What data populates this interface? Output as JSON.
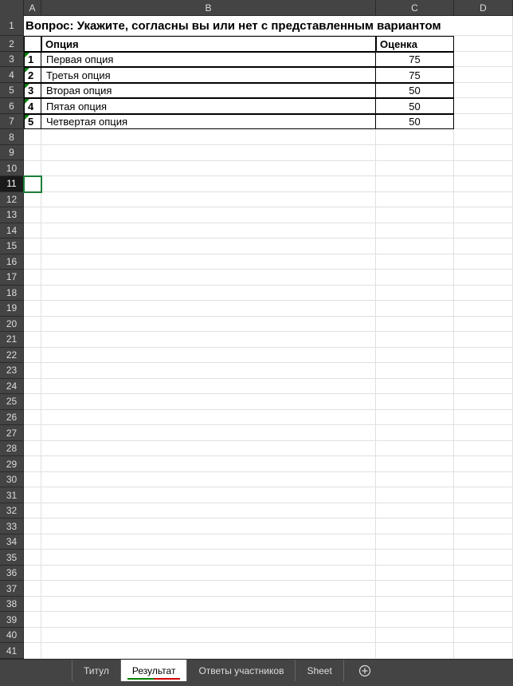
{
  "columns": [
    "A",
    "B",
    "C",
    "D"
  ],
  "title": "Вопрос: Укажите, согласны вы или нет с представленным вариантом",
  "headers": {
    "option": "Опция",
    "score": "Оценка"
  },
  "rows": [
    {
      "n": "1",
      "option": "Первая опция",
      "score": "75"
    },
    {
      "n": "2",
      "option": "Третья опция",
      "score": "75"
    },
    {
      "n": "3",
      "option": "Вторая опция",
      "score": "50"
    },
    {
      "n": "4",
      "option": "Пятая опция",
      "score": "50"
    },
    {
      "n": "5",
      "option": "Четвертая опция",
      "score": "50"
    }
  ],
  "row_numbers_visible": 41,
  "selected_row": 11,
  "tabs": [
    {
      "label": "Титул",
      "active": false
    },
    {
      "label": "Результат",
      "active": true
    },
    {
      "label": "Ответы участников",
      "active": false
    },
    {
      "label": "Sheet",
      "active": false
    }
  ],
  "chart_data": {
    "type": "table",
    "title": "Вопрос: Укажите, согласны вы или нет с представленным вариантом",
    "columns": [
      "Опция",
      "Оценка"
    ],
    "rows": [
      [
        "Первая опция",
        75
      ],
      [
        "Третья опция",
        75
      ],
      [
        "Вторая опция",
        50
      ],
      [
        "Пятая опция",
        50
      ],
      [
        "Четвертая опция",
        50
      ]
    ]
  }
}
